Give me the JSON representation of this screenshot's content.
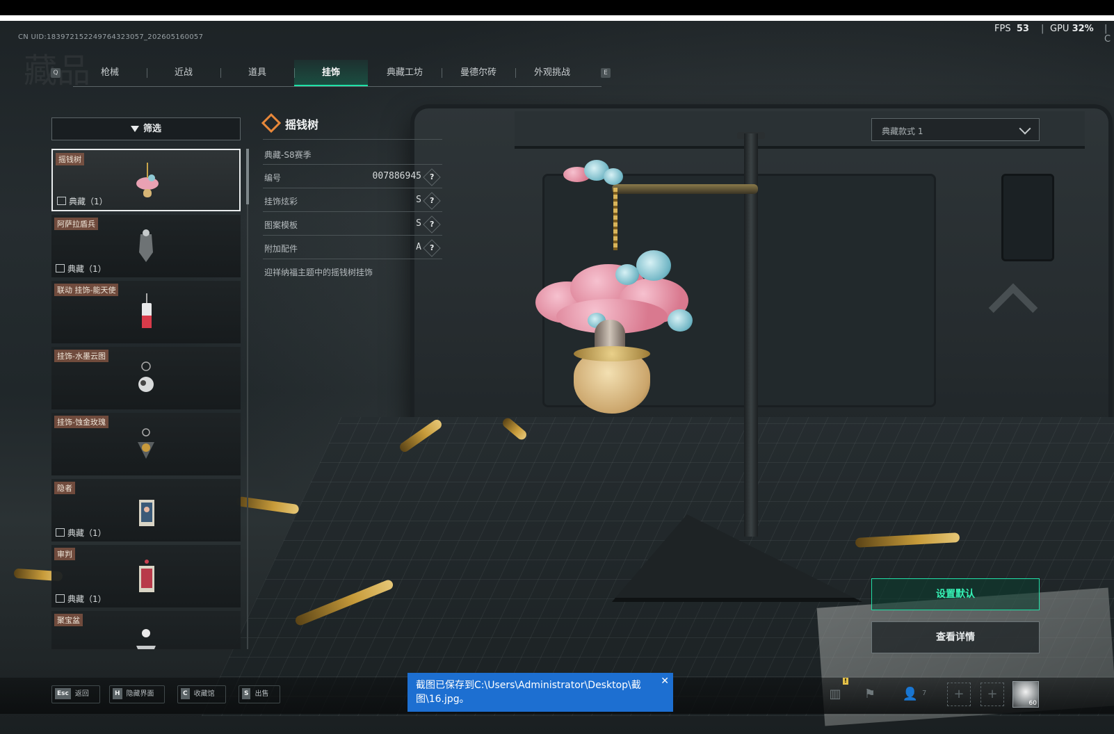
{
  "window": {
    "uid": "CN UID:183972152249764323057_202605160057",
    "watermark": "藏品"
  },
  "perf": {
    "fps_label": "FPS",
    "fps_value": "53",
    "separator": "|",
    "gpu_label": "GPU",
    "gpu_value": "32",
    "gpu_unit": "%",
    "trailing": "|",
    "clipped": "C"
  },
  "tabs": {
    "prev_key": "Q",
    "next_key": "E",
    "items": [
      {
        "label": "枪械"
      },
      {
        "label": "近战"
      },
      {
        "label": "道具"
      },
      {
        "label": "挂饰"
      },
      {
        "label": "典藏工坊"
      },
      {
        "label": "曼德尔砖"
      },
      {
        "label": "外观挑战"
      }
    ],
    "active": "挂饰"
  },
  "filter": {
    "label": "筛选"
  },
  "items": [
    {
      "name": "摇钱树",
      "tag": "典藏（1）",
      "selected": true
    },
    {
      "name": "阿萨拉盾兵",
      "tag": "典藏（1）"
    },
    {
      "name": "联动  挂饰-能天使",
      "tag": ""
    },
    {
      "name": "挂饰-水墨云图",
      "tag": ""
    },
    {
      "name": "挂饰-蚀金玫瑰",
      "tag": ""
    },
    {
      "name": "隐者",
      "tag": "典藏（1）"
    },
    {
      "name": "审判",
      "tag": "典藏（1）"
    },
    {
      "name": "聚宝盆",
      "tag": ""
    }
  ],
  "detail": {
    "title": "摇钱树",
    "subtitle": "典藏-S8赛季",
    "rows": [
      {
        "label": "编号",
        "value": "007886945",
        "help": "?"
      },
      {
        "label": "挂饰炫彩",
        "value": "S",
        "help": "?"
      },
      {
        "label": "图案模板",
        "value": "S",
        "help": "?"
      },
      {
        "label": "附加配件",
        "value": "A",
        "help": "?"
      }
    ],
    "description": "迎祥纳福主题中的摇钱树挂饰"
  },
  "style_select": {
    "value": "典藏款式 1"
  },
  "actions": {
    "set_default": "设置默认",
    "view_detail": "查看详情"
  },
  "bottom_hints": [
    {
      "key": "Esc",
      "label": "返回"
    },
    {
      "key": "H",
      "label": "隐藏界面"
    },
    {
      "key": "C",
      "label": "收藏馆"
    },
    {
      "key": "S",
      "label": "出售"
    }
  ],
  "toast": {
    "message": "截图已保存到C:\\Users\\Administrator\\Desktop\\截图\\16.jpg。",
    "close": "✕"
  },
  "bottom_right": {
    "warn": "!",
    "friends_count": "7",
    "slot_plus": "+",
    "level": "60"
  },
  "colors": {
    "accent": "#1fe0a6",
    "toast_bg": "#1d6fd1",
    "tag_bg": "#8c5a46"
  }
}
